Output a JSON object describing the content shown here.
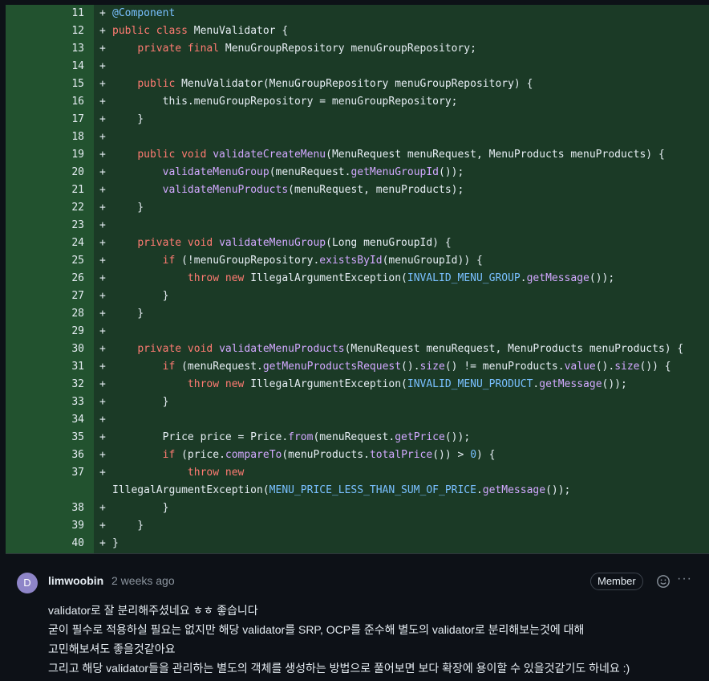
{
  "diff": {
    "lines": [
      {
        "num": "11",
        "sign": "+",
        "tokens": [
          {
            "t": "@Component",
            "cls": "a"
          }
        ]
      },
      {
        "num": "12",
        "sign": "+",
        "tokens": [
          {
            "t": "public class",
            "cls": "k"
          },
          {
            "t": " MenuValidator {"
          }
        ]
      },
      {
        "num": "13",
        "sign": "+",
        "tokens": [
          {
            "t": "    "
          },
          {
            "t": "private final",
            "cls": "k"
          },
          {
            "t": " MenuGroupRepository menuGroupRepository;"
          }
        ]
      },
      {
        "num": "14",
        "sign": "+",
        "tokens": []
      },
      {
        "num": "15",
        "sign": "+",
        "tokens": [
          {
            "t": "    "
          },
          {
            "t": "public",
            "cls": "k"
          },
          {
            "t": " MenuValidator(MenuGroupRepository menuGroupRepository) {"
          }
        ]
      },
      {
        "num": "16",
        "sign": "+",
        "tokens": [
          {
            "t": "        this.menuGroupRepository = menuGroupRepository;"
          }
        ]
      },
      {
        "num": "17",
        "sign": "+",
        "tokens": [
          {
            "t": "    }"
          }
        ]
      },
      {
        "num": "18",
        "sign": "+",
        "tokens": []
      },
      {
        "num": "19",
        "sign": "+",
        "tokens": [
          {
            "t": "    "
          },
          {
            "t": "public void",
            "cls": "k"
          },
          {
            "t": " "
          },
          {
            "t": "validateCreateMenu",
            "cls": "f"
          },
          {
            "t": "(MenuRequest menuRequest, MenuProducts menuProducts) {"
          }
        ]
      },
      {
        "num": "20",
        "sign": "+",
        "tokens": [
          {
            "t": "        "
          },
          {
            "t": "validateMenuGroup",
            "cls": "f"
          },
          {
            "t": "(menuRequest."
          },
          {
            "t": "getMenuGroupId",
            "cls": "f"
          },
          {
            "t": "());"
          }
        ]
      },
      {
        "num": "21",
        "sign": "+",
        "tokens": [
          {
            "t": "        "
          },
          {
            "t": "validateMenuProducts",
            "cls": "f"
          },
          {
            "t": "(menuRequest, menuProducts);"
          }
        ]
      },
      {
        "num": "22",
        "sign": "+",
        "tokens": [
          {
            "t": "    }"
          }
        ]
      },
      {
        "num": "23",
        "sign": "+",
        "tokens": []
      },
      {
        "num": "24",
        "sign": "+",
        "tokens": [
          {
            "t": "    "
          },
          {
            "t": "private void",
            "cls": "k"
          },
          {
            "t": " "
          },
          {
            "t": "validateMenuGroup",
            "cls": "f"
          },
          {
            "t": "(Long menuGroupId) {"
          }
        ]
      },
      {
        "num": "25",
        "sign": "+",
        "tokens": [
          {
            "t": "        "
          },
          {
            "t": "if",
            "cls": "k"
          },
          {
            "t": " (!menuGroupRepository."
          },
          {
            "t": "existsById",
            "cls": "f"
          },
          {
            "t": "(menuGroupId)) {"
          }
        ]
      },
      {
        "num": "26",
        "sign": "+",
        "tokens": [
          {
            "t": "            "
          },
          {
            "t": "throw new",
            "cls": "k"
          },
          {
            "t": " IllegalArgumentException("
          },
          {
            "t": "INVALID_MENU_GROUP",
            "cls": "c"
          },
          {
            "t": "."
          },
          {
            "t": "getMessage",
            "cls": "f"
          },
          {
            "t": "());"
          }
        ]
      },
      {
        "num": "27",
        "sign": "+",
        "tokens": [
          {
            "t": "        }"
          }
        ]
      },
      {
        "num": "28",
        "sign": "+",
        "tokens": [
          {
            "t": "    }"
          }
        ]
      },
      {
        "num": "29",
        "sign": "+",
        "tokens": []
      },
      {
        "num": "30",
        "sign": "+",
        "tokens": [
          {
            "t": "    "
          },
          {
            "t": "private void",
            "cls": "k"
          },
          {
            "t": " "
          },
          {
            "t": "validateMenuProducts",
            "cls": "f"
          },
          {
            "t": "(MenuRequest menuRequest, MenuProducts menuProducts) {"
          }
        ]
      },
      {
        "num": "31",
        "sign": "+",
        "tokens": [
          {
            "t": "        "
          },
          {
            "t": "if",
            "cls": "k"
          },
          {
            "t": " (menuRequest."
          },
          {
            "t": "getMenuProductsRequest",
            "cls": "f"
          },
          {
            "t": "()."
          },
          {
            "t": "size",
            "cls": "f"
          },
          {
            "t": "() != menuProducts."
          },
          {
            "t": "value",
            "cls": "f"
          },
          {
            "t": "()."
          },
          {
            "t": "size",
            "cls": "f"
          },
          {
            "t": "()) {"
          }
        ]
      },
      {
        "num": "32",
        "sign": "+",
        "tokens": [
          {
            "t": "            "
          },
          {
            "t": "throw new",
            "cls": "k"
          },
          {
            "t": " IllegalArgumentException("
          },
          {
            "t": "INVALID_MENU_PRODUCT",
            "cls": "c"
          },
          {
            "t": "."
          },
          {
            "t": "getMessage",
            "cls": "f"
          },
          {
            "t": "());"
          }
        ]
      },
      {
        "num": "33",
        "sign": "+",
        "tokens": [
          {
            "t": "        }"
          }
        ]
      },
      {
        "num": "34",
        "sign": "+",
        "tokens": []
      },
      {
        "num": "35",
        "sign": "+",
        "tokens": [
          {
            "t": "        Price price = Price."
          },
          {
            "t": "from",
            "cls": "f"
          },
          {
            "t": "(menuRequest."
          },
          {
            "t": "getPrice",
            "cls": "f"
          },
          {
            "t": "());"
          }
        ]
      },
      {
        "num": "36",
        "sign": "+",
        "tokens": [
          {
            "t": "        "
          },
          {
            "t": "if",
            "cls": "k"
          },
          {
            "t": " (price."
          },
          {
            "t": "compareTo",
            "cls": "f"
          },
          {
            "t": "(menuProducts."
          },
          {
            "t": "totalPrice",
            "cls": "f"
          },
          {
            "t": "()) > "
          },
          {
            "t": "0",
            "cls": "c"
          },
          {
            "t": ") {"
          }
        ]
      },
      {
        "num": "37",
        "sign": "+",
        "tokens": [
          {
            "t": "            "
          },
          {
            "t": "throw new",
            "cls": "k"
          }
        ]
      },
      {
        "num": "",
        "sign": "",
        "wrap": true,
        "tokens": [
          {
            "t": "IllegalArgumentException("
          },
          {
            "t": "MENU_PRICE_LESS_THAN_SUM_OF_PRICE",
            "cls": "c"
          },
          {
            "t": "."
          },
          {
            "t": "getMessage",
            "cls": "f"
          },
          {
            "t": "());"
          }
        ]
      },
      {
        "num": "38",
        "sign": "+",
        "tokens": [
          {
            "t": "        }"
          }
        ]
      },
      {
        "num": "39",
        "sign": "+",
        "tokens": [
          {
            "t": "    }"
          }
        ]
      },
      {
        "num": "40",
        "sign": "+",
        "tokens": [
          {
            "t": "}"
          }
        ]
      }
    ]
  },
  "comment": {
    "avatar_letter": "D",
    "author": "limwoobin",
    "time": "2 weeks ago",
    "badge": "Member",
    "more": "···",
    "body": [
      "validator로 잘 분리해주셨네요 ㅎㅎ 좋습니다",
      "굳이 필수로 적용하실 필요는 없지만 해당 validator를 SRP, OCP를 준수해 별도의 validator로 분리해보는것에 대해",
      "고민해보셔도 좋을것같아요",
      "그리고 해당 validator들을 관리하는 별도의 객체를 생성하는 방법으로 풀어보면 보다 확장에 용이할 수 있을것같기도 하네요 :)"
    ]
  },
  "colors": {
    "diff_bg": "#1b3a26",
    "gutter_bg": "#22522f",
    "keyword": "#ff7b72",
    "function": "#d2a8ff",
    "constant": "#79c0ff"
  }
}
